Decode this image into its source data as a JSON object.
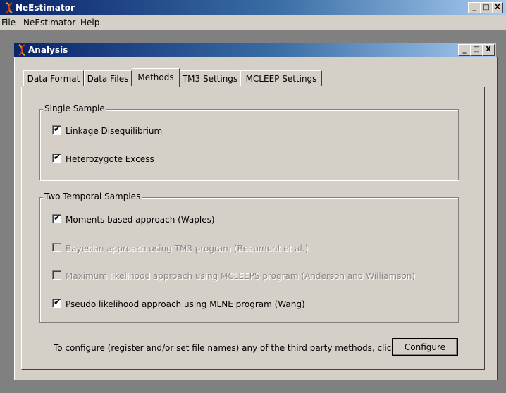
{
  "app": {
    "title": "NeEstimator",
    "menu": [
      "File",
      "NeEstimator",
      "Help"
    ],
    "window_buttons": {
      "minimize": "_",
      "maximize": "□",
      "close": "X"
    }
  },
  "child_window": {
    "title": "Analysis",
    "buttons": {
      "minimize": "_",
      "maximize": "□",
      "close": "X"
    }
  },
  "tabs": [
    {
      "label": "Data Format"
    },
    {
      "label": "Data Files"
    },
    {
      "label": "Methods",
      "active": true
    },
    {
      "label": "TM3 Settings"
    },
    {
      "label": "MCLEEP Settings"
    }
  ],
  "single_sample": {
    "label": "Single Sample",
    "options": [
      {
        "label": "Linkage Disequilibrium",
        "checked": true,
        "enabled": true
      },
      {
        "label": "Heterozygote Excess",
        "checked": true,
        "enabled": true
      }
    ]
  },
  "two_temporal": {
    "label": "Two Temporal Samples",
    "options": [
      {
        "label": "Moments based approach (Waples)",
        "checked": true,
        "enabled": true
      },
      {
        "label": "Bayesian approach using TM3 program (Beaumont et al.)",
        "checked": false,
        "enabled": false
      },
      {
        "label": "Maximum likelihood approach using MCLEEPS program (Anderson and Williamson)",
        "checked": false,
        "enabled": false
      },
      {
        "label": "Pseudo likelihood approach using MLNE program (Wang)",
        "checked": true,
        "enabled": true
      }
    ]
  },
  "configure": {
    "text": "To configure (register and/or set file names) any of the third party methods, click here:",
    "button_label": "Configure"
  },
  "colors": {
    "titlebar_start": "#0a246a",
    "titlebar_end": "#a6caf0",
    "face": "#d4d0c8",
    "mdi_background": "#808080"
  },
  "icons": {
    "app_icon": "dna-icon",
    "check_mark": "✔"
  }
}
